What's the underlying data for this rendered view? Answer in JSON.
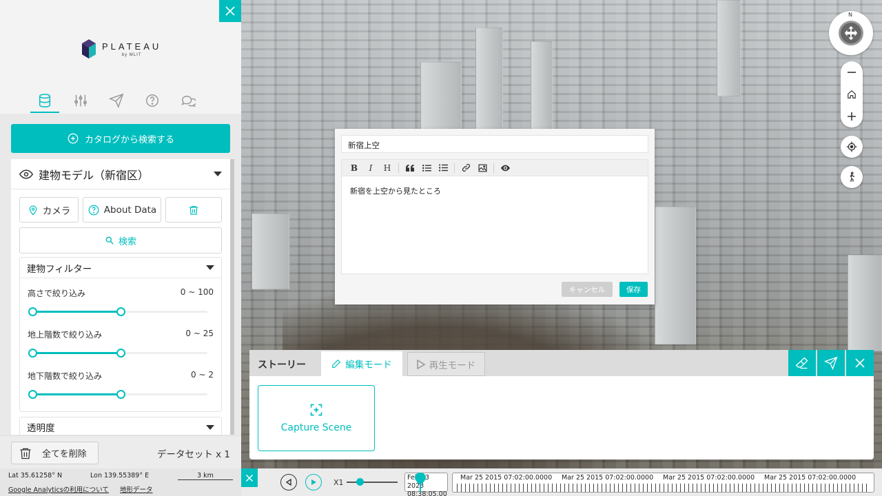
{
  "app": {
    "logo_title": "PLATEAU",
    "logo_subtitle": "by MLIT",
    "brand_color": "#00bebe"
  },
  "left_panel": {
    "nav_tabs": [
      {
        "icon": "database-icon",
        "active": true
      },
      {
        "icon": "sliders-icon",
        "active": false
      },
      {
        "icon": "send-icon",
        "active": false
      },
      {
        "icon": "help-icon",
        "active": false
      },
      {
        "icon": "chat-icon",
        "active": false
      }
    ],
    "catalog_button": "カタログから検索する",
    "dataset": {
      "title": "建物モデル（新宿区）",
      "camera_button": "カメラ",
      "about_button": "About Data",
      "search_button": "検索",
      "filter_title": "建物フィルター",
      "filters": [
        {
          "label": "高さで絞り込み",
          "value": "0 ~ 100",
          "range": [
            0,
            100
          ]
        },
        {
          "label": "地上階数で絞り込み",
          "value": "0 ~ 25",
          "range": [
            0,
            25
          ]
        },
        {
          "label": "地下階数で絞り込み",
          "value": "0 ~ 2",
          "range": [
            0,
            2
          ]
        }
      ],
      "opacity_title": "透明度"
    },
    "delete_all": "全てを削除",
    "dataset_count": "データセット x 1",
    "status": {
      "lat": "Lat  35.61258° N",
      "lon": "Lon  139.55389° E",
      "scale": "3 km",
      "ga_link": "Google Analyticsの利用について",
      "geo_link": "地形データ"
    }
  },
  "editor": {
    "title_value": "新宿上空",
    "body_text": "新宿を上空から見たところ",
    "toolbar": [
      "B",
      "I",
      "H"
    ],
    "cancel": "キャンセル",
    "save": "保存"
  },
  "story": {
    "label": "ストーリー",
    "edit_tab": "編集モード",
    "play_tab": "再生モード",
    "capture": "Capture Scene"
  },
  "timeline": {
    "speed": "X1",
    "date_line1": "Feb 23 2023",
    "date_line2": "08:38:05.00",
    "labels": [
      "Mar 25 2015 07:02:00.0000",
      "Mar 25 2015 07:02:00.0000",
      "Mar 25 2015 07:02:00.0000",
      "Mar 25 2015 07:02:00.0000"
    ]
  },
  "map": {
    "compass_north": "N"
  }
}
